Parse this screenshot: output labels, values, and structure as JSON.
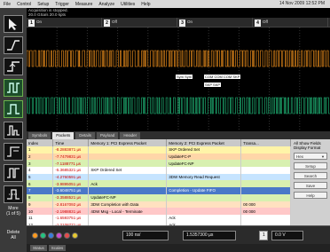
{
  "menu": [
    "File",
    "Control",
    "Setup",
    "Trigger",
    "Measure",
    "Analyze",
    "Utilities",
    "Help"
  ],
  "datetime": "14 Nov 2009 12:52 PM",
  "status": {
    "line1": "Acquisition is stopped.",
    "line2": "20.0 GSa/s   20.0 kpts"
  },
  "channels": [
    {
      "num": "1",
      "label": "On"
    },
    {
      "num": "2",
      "label": "Off"
    },
    {
      "num": "3",
      "label": "On"
    },
    {
      "num": "4",
      "label": "Off"
    }
  ],
  "decode_labels": [
    "Sym   Sym",
    "COM  COM  COM  SKP",
    "SKP  SKP"
  ],
  "left_panel": {
    "more_label": "More\n(1 of 5)",
    "delete_label": "Delete\nAll"
  },
  "tabs": [
    "Symbols",
    "Packets",
    "Details",
    "Payload",
    "Header"
  ],
  "active_tab": "Packets",
  "table": {
    "headers": [
      "Index",
      "Time",
      "Memory 1: PCI Express Packet",
      "Memory 2: PCI Express Packet",
      "Transa..."
    ],
    "rows": [
      {
        "index": "1",
        "time": "-8.2883871 µs",
        "m1": "",
        "m2": "SKP Ordered Set",
        "tr": ""
      },
      {
        "index": "2",
        "time": "-7.7479831 µs",
        "m1": "",
        "m2": "UpdateFC-P",
        "tr": ""
      },
      {
        "index": "3",
        "time": "-7.1188771 µs",
        "m1": "",
        "m2": "UpdateFC-NP",
        "tr": ""
      },
      {
        "index": "4",
        "time": "-5.3685321 µs",
        "m1": "SKP Ordered Set",
        "m2": "",
        "tr": ""
      },
      {
        "index": "5",
        "time": "-4.2760591 µs",
        "m1": "",
        "m2": "3DW Memory Read Request",
        "tr": ""
      },
      {
        "index": "6",
        "time": "-3.9895051 µs",
        "m1": "Ack",
        "m2": "",
        "tr": ""
      },
      {
        "index": "7",
        "time": "-3.6048751 µs",
        "m1": "",
        "m2": "Completion - Update FIFO",
        "tr": ""
      },
      {
        "index": "8",
        "time": "-3.3588521 µs",
        "m1": "UpdateFC-NP",
        "m2": "",
        "tr": ""
      },
      {
        "index": "9",
        "time": "-2.8167092 µs",
        "m1": "3DW Completion with Data",
        "m2": "",
        "tr": "00 000"
      },
      {
        "index": "10",
        "time": "-2.1988831 µs",
        "m1": "4DW Msg - Local - Terminate",
        "m2": "",
        "tr": "00 000"
      },
      {
        "index": "11",
        "time": "-1.6593751 µs",
        "m1": "",
        "m2": "Ack",
        "tr": ""
      },
      {
        "index": "12",
        "time": "-1.2108771 µs",
        "m1": "",
        "m2": "Ack",
        "tr": ""
      }
    ]
  },
  "side_panel": {
    "title": "All Show Fields",
    "display_format_label": "Display Format",
    "display_format_value": "Hex",
    "buttons": [
      "Setup",
      "Search",
      "Save",
      "Help"
    ]
  },
  "bottom": {
    "time_div": "100 ns/",
    "delay": "1.5357300 µs",
    "channel_num": "1",
    "trigger_level": "0.0 V"
  },
  "status_tabs": [
    "Status",
    "Scales"
  ],
  "colors": {
    "channel1": "#ff9a1e",
    "channel3": "#22c480",
    "selected_row": "#4a78c8"
  }
}
